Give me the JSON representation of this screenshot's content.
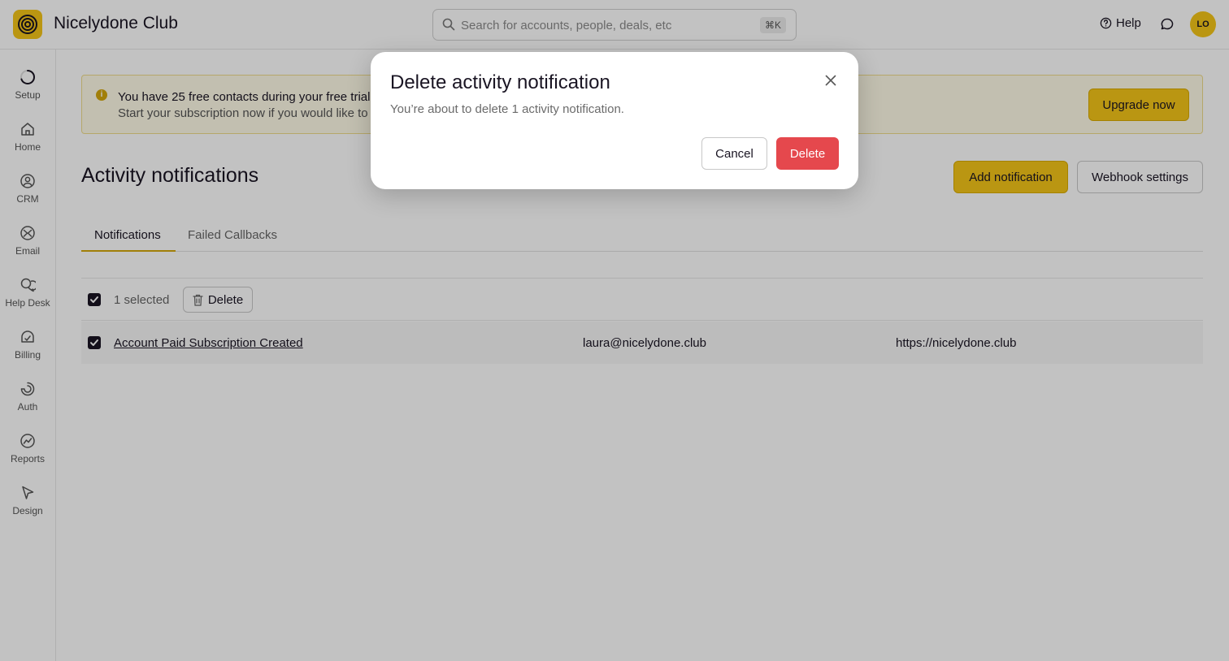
{
  "app": {
    "name": "Nicelydone Club",
    "user_initials": "LO"
  },
  "search": {
    "placeholder": "Search for accounts, people, deals, etc",
    "shortcut": "⌘K"
  },
  "header": {
    "help_label": "Help"
  },
  "sidebar": {
    "items": [
      {
        "label": "Setup",
        "icon": "setup-progress-icon"
      },
      {
        "label": "Home",
        "icon": "home-icon"
      },
      {
        "label": "CRM",
        "icon": "crm-icon"
      },
      {
        "label": "Email",
        "icon": "email-icon"
      },
      {
        "label": "Help Desk",
        "icon": "help-desk-icon"
      },
      {
        "label": "Billing",
        "icon": "billing-icon"
      },
      {
        "label": "Auth",
        "icon": "auth-icon"
      },
      {
        "label": "Reports",
        "icon": "reports-icon"
      },
      {
        "label": "Design",
        "icon": "design-icon"
      }
    ]
  },
  "banner": {
    "title": "You have 25 free contacts during your free trial",
    "subtitle": "Start your subscription now if you would like to i",
    "upgrade_label": "Upgrade now"
  },
  "page": {
    "title": "Activity notifications",
    "add_label": "Add notification",
    "webhook_label": "Webhook settings",
    "tabs": [
      {
        "label": "Notifications",
        "active": true
      },
      {
        "label": "Failed Callbacks",
        "active": false
      }
    ]
  },
  "table": {
    "selected_text": "1 selected",
    "bulk_delete_label": "Delete",
    "rows": [
      {
        "name": "Account Paid Subscription Created",
        "email": "laura@nicelydone.club",
        "url": "https://nicelydone.club",
        "checked": true
      }
    ]
  },
  "modal": {
    "title": "Delete activity notification",
    "description": "You’re about to delete 1 activity notification.",
    "cancel_label": "Cancel",
    "delete_label": "Delete"
  },
  "colors": {
    "accent": "#f5c518",
    "danger": "#e5484d",
    "text": "#1a1523"
  }
}
